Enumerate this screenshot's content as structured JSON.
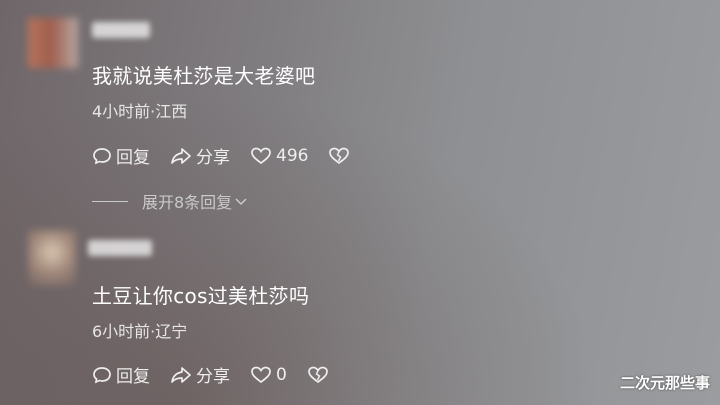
{
  "comments": [
    {
      "text": "我就说美杜莎是大老婆吧",
      "meta": "4小时前·江西",
      "reply_label": "回复",
      "share_label": "分享",
      "like_count": "496"
    },
    {
      "text": "土豆让你cos过美杜莎吗",
      "meta": "6小时前·辽宁",
      "reply_label": "回复",
      "share_label": "分享",
      "like_count": "0"
    }
  ],
  "expand_replies": "展开8条回复",
  "watermark": "二次元那些事",
  "icons": {
    "reply": "speech-bubble-icon",
    "share": "share-arrow-icon",
    "like": "heart-icon",
    "dislike": "broken-heart-icon",
    "expand": "chevron-down-icon"
  }
}
